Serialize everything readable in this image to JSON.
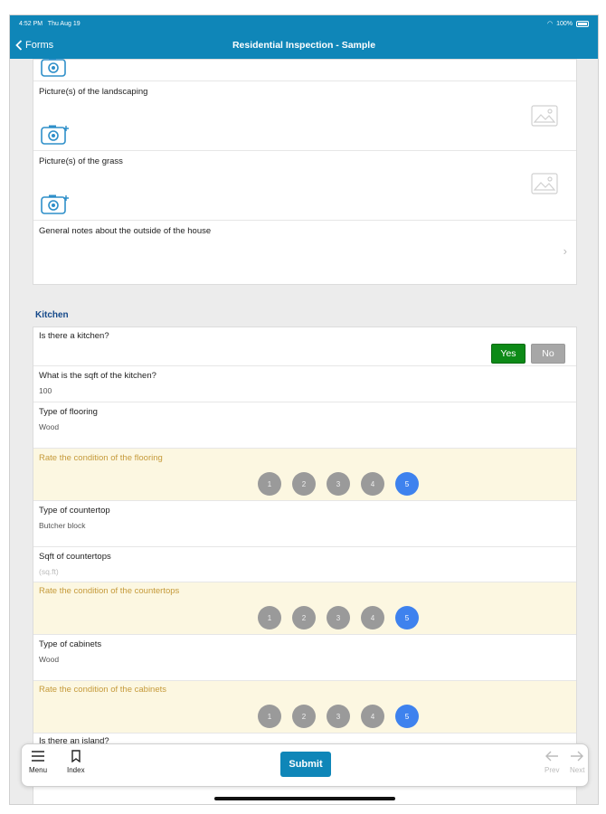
{
  "status_bar": {
    "time": "4:52 PM",
    "date": "Thu Aug 19",
    "battery": "100%"
  },
  "nav": {
    "back_label": "Forms",
    "title": "Residential Inspection - Sample"
  },
  "outside": {
    "landscaping_label": "Picture(s) of the landscaping",
    "grass_label": "Picture(s) of the grass",
    "notes_label": "General notes about the outside of the house"
  },
  "kitchen": {
    "section_title": "Kitchen",
    "has_kitchen_label": "Is there a kitchen?",
    "yes_label": "Yes",
    "no_label": "No",
    "sqft_label": "What is the sqft of the kitchen?",
    "sqft_value": "100",
    "flooring_label": "Type of flooring",
    "flooring_value": "Wood",
    "rate_flooring_label": "Rate the condition of the flooring",
    "countertop_label": "Type of countertop",
    "countertop_value": "Butcher block",
    "countertop_sqft_label": "Sqft of countertops",
    "countertop_sqft_placeholder": "(sq.ft)",
    "rate_countertops_label": "Rate the condition of the countertops",
    "cabinets_label": "Type of cabinets",
    "cabinets_value": "Wood",
    "rate_cabinets_label": "Rate the condition of the cabinets",
    "island_label": "Is there an island?"
  },
  "ratings": {
    "options": [
      "1",
      "2",
      "3",
      "4",
      "5"
    ],
    "flooring_selected": 5,
    "countertops_selected": 5,
    "cabinets_selected": 5
  },
  "toolbar": {
    "menu_label": "Menu",
    "index_label": "Index",
    "submit_label": "Submit",
    "prev_label": "Prev",
    "next_label": "Next"
  },
  "colors": {
    "header": "#0f86b8",
    "yes": "#0d8a17",
    "no": "#a7a7a7",
    "rating_selected": "#3e82ee",
    "rating_default": "#9a9a9a",
    "rate_row_bg": "#fcf7e1"
  }
}
